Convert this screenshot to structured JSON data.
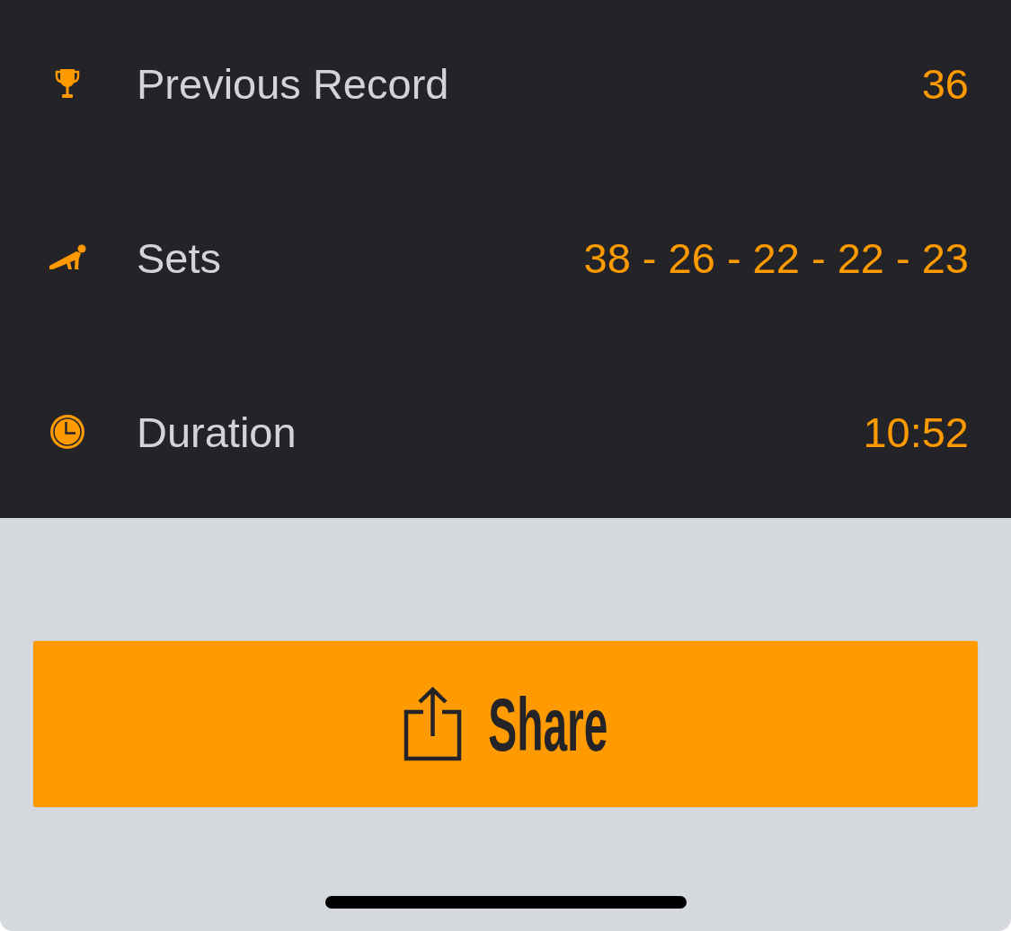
{
  "stats": [
    {
      "kind": "record",
      "label": "Previous Record",
      "value": "36"
    },
    {
      "kind": "sets",
      "label": "Sets",
      "value": "38 - 26 - 22 - 22 - 23"
    },
    {
      "kind": "duration",
      "label": "Duration",
      "value": "10:52"
    }
  ],
  "share_button": {
    "label": "Share"
  }
}
